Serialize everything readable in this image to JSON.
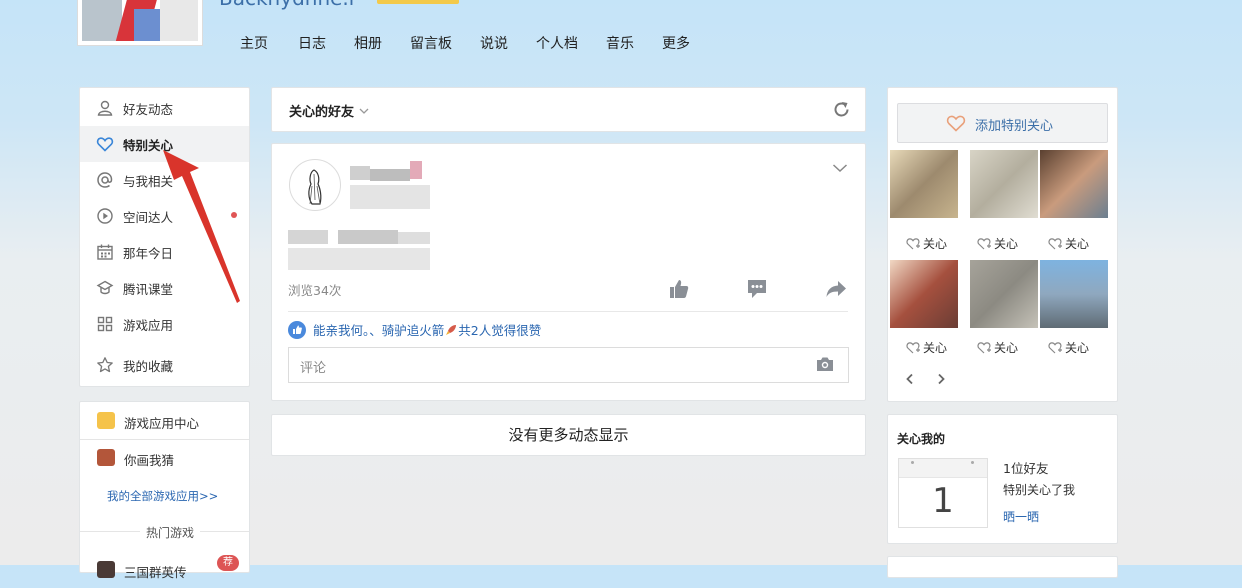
{
  "header": {
    "username": "Backhydhne.r",
    "nav": [
      "主页",
      "日志",
      "相册",
      "留言板",
      "说说",
      "个人档",
      "音乐",
      "更多"
    ]
  },
  "left_menu": [
    {
      "label": "好友动态",
      "icon": "person-icon"
    },
    {
      "label": "特别关心",
      "icon": "heart-icon",
      "active": true
    },
    {
      "label": "与我相关",
      "icon": "at-icon"
    },
    {
      "label": "空间达人",
      "icon": "play-circle-icon",
      "has_dot": true
    },
    {
      "label": "那年今日",
      "icon": "calendar-icon"
    },
    {
      "label": "腾讯课堂",
      "icon": "graduation-cap-icon"
    },
    {
      "label": "游戏应用",
      "icon": "apps-grid-icon"
    },
    {
      "label": "我的收藏",
      "icon": "star-icon"
    }
  ],
  "games": {
    "center": "游戏应用中心",
    "game1": "你画我猜",
    "all_link": "我的全部游戏应用>>",
    "hot_title": "热门游戏",
    "hot1": "三国群英传",
    "hot1_badge": "荐"
  },
  "feed": {
    "filter_label": "关心的好友",
    "views": "浏览34次",
    "likes_text": "能亲我何。、骑驴追火箭",
    "likes_suffix": "共2人觉得很赞",
    "comment_placeholder": "评论",
    "no_more": "没有更多动态显示"
  },
  "special_care": {
    "add_label": "添加特别关心",
    "care_label": "关心",
    "friend_count": 6
  },
  "cares_me": {
    "title": "关心我的",
    "number": "1",
    "line1": "1位好友",
    "line2": "特别关心了我",
    "link": "晒一晒"
  },
  "colors": {
    "accent_red": "#d9342b",
    "link_blue": "#2a66b0",
    "heart_orange": "#e9a07a"
  }
}
